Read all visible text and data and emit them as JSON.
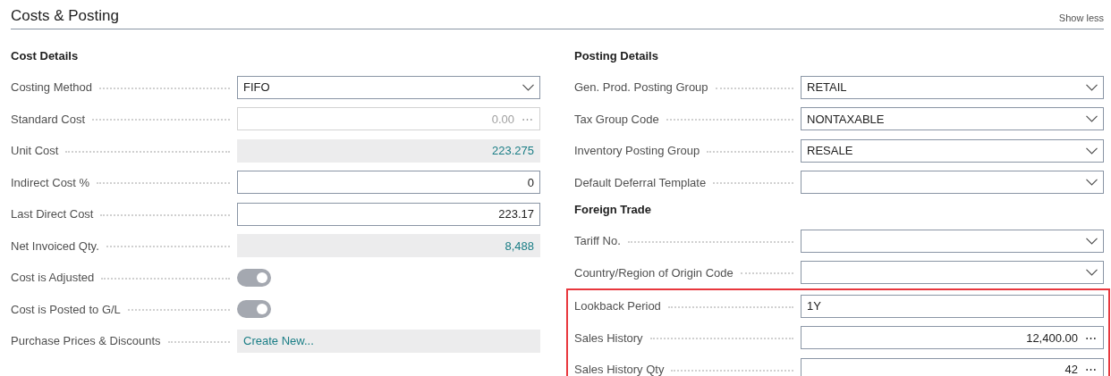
{
  "header": {
    "title": "Costs & Posting",
    "action": "Show less"
  },
  "columns": [
    {
      "sections": [
        {
          "heading": "Cost Details",
          "highlighted": false,
          "fields": [
            {
              "label": "Costing Method",
              "kind": "select",
              "value": "FIFO"
            },
            {
              "label": "Standard Cost",
              "kind": "disabled",
              "value": "0.00",
              "more": "⋯"
            },
            {
              "label": "Unit Cost",
              "kind": "readonly",
              "value": "223.275"
            },
            {
              "label": "Indirect Cost %",
              "kind": "number",
              "value": "0"
            },
            {
              "label": "Last Direct Cost",
              "kind": "number",
              "value": "223.17"
            },
            {
              "label": "Net Invoiced Qty.",
              "kind": "readonly",
              "value": "8,488"
            },
            {
              "label": "Cost is Adjusted",
              "kind": "toggle",
              "on": true
            },
            {
              "label": "Cost is Posted to G/L",
              "kind": "toggle",
              "on": true
            },
            {
              "label": "Purchase Prices & Discounts",
              "kind": "link",
              "value": "Create New..."
            }
          ]
        }
      ]
    },
    {
      "sections": [
        {
          "heading": "Posting Details",
          "highlighted": false,
          "fields": [
            {
              "label": "Gen. Prod. Posting Group",
              "kind": "select",
              "value": "RETAIL"
            },
            {
              "label": "Tax Group Code",
              "kind": "select",
              "value": "NONTAXABLE"
            },
            {
              "label": "Inventory Posting Group",
              "kind": "select",
              "value": "RESALE"
            },
            {
              "label": "Default Deferral Template",
              "kind": "select"
            }
          ]
        },
        {
          "heading": "Foreign Trade",
          "highlighted": false,
          "fields": [
            {
              "label": "Tariff No.",
              "kind": "select"
            },
            {
              "label": "Country/Region of Origin Code",
              "kind": "select"
            }
          ]
        },
        {
          "highlighted": true,
          "fields": [
            {
              "label": "Lookback Period",
              "kind": "text",
              "value": "1Y"
            },
            {
              "label": "Sales History",
              "kind": "number",
              "value": "12,400.00",
              "more": "⋯"
            },
            {
              "label": "Sales History Qty",
              "kind": "number",
              "value": "42",
              "more": "⋯"
            }
          ]
        }
      ]
    }
  ]
}
